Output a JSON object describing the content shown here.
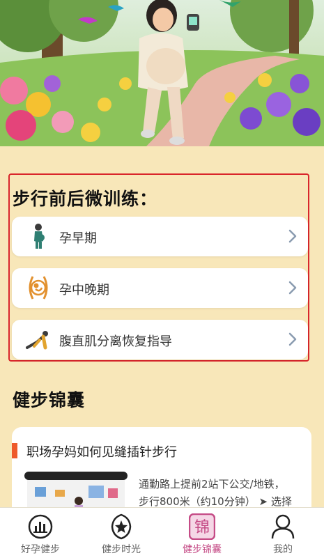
{
  "hero": {
    "illustration": "pregnant-woman-walking-in-park"
  },
  "walk_section": {
    "title": "步行前后微训练：",
    "items": [
      {
        "label": "孕早期",
        "icon": "standing-pregnant-woman-icon"
      },
      {
        "label": "孕中晚期",
        "icon": "fetus-in-belly-icon"
      },
      {
        "label": "腹直肌分离恢复指导",
        "icon": "yoga-pose-icon"
      }
    ]
  },
  "tips_section": {
    "title": "健步锦囊",
    "card": {
      "title": "职场孕妈如何见缝插针步行",
      "text_line1": "通勤路上提前2站下公交/地铁，",
      "text_line2": "步行800米（约10分钟） ➤ 选择"
    }
  },
  "nav": {
    "items": [
      {
        "label": "好孕健步",
        "icon": "bar-chart-icon"
      },
      {
        "label": "健步时光",
        "icon": "star-shield-icon"
      },
      {
        "label": "健步锦囊",
        "icon": "jin-character-icon",
        "glyph": "锦"
      },
      {
        "label": "我的",
        "icon": "user-icon"
      }
    ],
    "active_index": 2
  },
  "colors": {
    "background": "#f8e7b9",
    "highlight_border": "#d9262b",
    "accent_bar": "#ee5a2b",
    "active_nav": "#c54b86"
  }
}
